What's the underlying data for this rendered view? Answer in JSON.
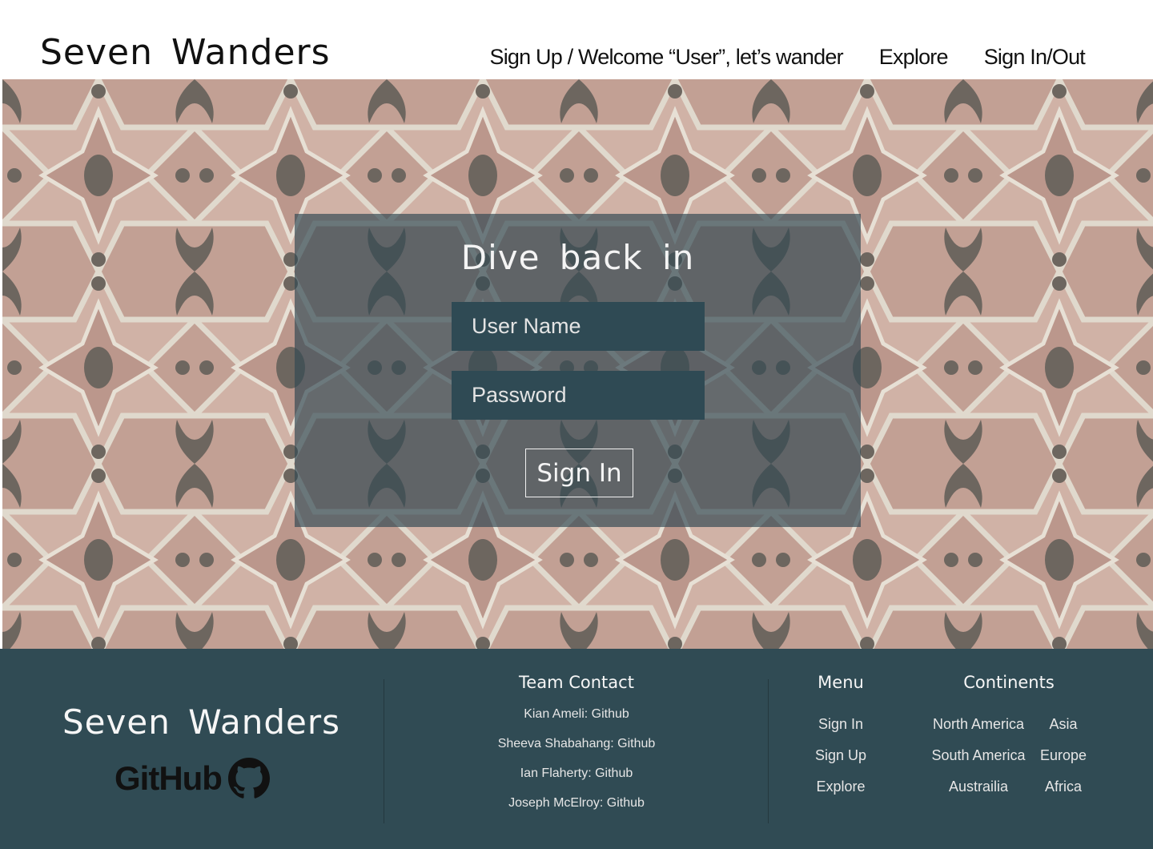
{
  "header": {
    "brand": "Seven Wanders",
    "nav": [
      {
        "label": "Sign Up / Welcome “User”, let’s wander"
      },
      {
        "label": "Explore"
      },
      {
        "label": "Sign In/Out"
      }
    ]
  },
  "signin": {
    "title": "Dive back in",
    "username_placeholder": "User Name",
    "password_placeholder": "Password",
    "button_label": "Sign In"
  },
  "footer": {
    "brand": "Seven Wanders",
    "github_logo_text": "GitHub",
    "team": {
      "heading": "Team Contact",
      "members": [
        "Kian Ameli: Github",
        "Sheeva Shabahang: Github",
        "Ian Flaherty: Github",
        "Joseph McElroy: Github"
      ]
    },
    "menu": {
      "heading": "Menu",
      "items": [
        "Sign In",
        "Sign Up",
        "Explore"
      ]
    },
    "continents": {
      "heading": "Continents",
      "items": [
        "North America",
        "Asia",
        "South America",
        "Europe",
        "Austrailia",
        "Africa"
      ]
    }
  },
  "colors": {
    "footer_bg": "#304b54",
    "panel_bg": "#324852",
    "field_bg": "#2f4a54"
  },
  "icons": {
    "github": "github-octocat-icon"
  }
}
